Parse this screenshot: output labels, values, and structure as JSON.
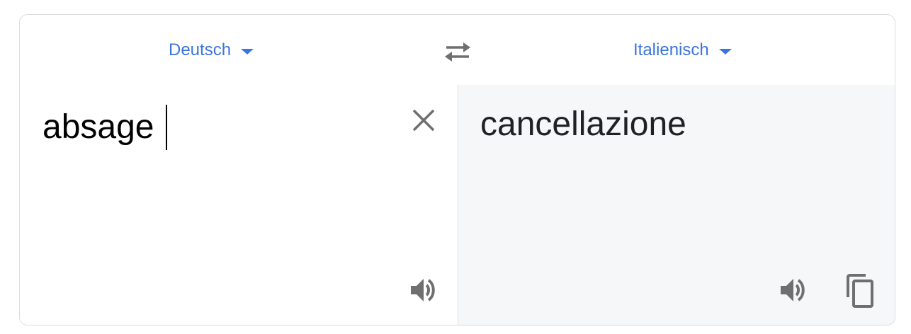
{
  "source_language": {
    "label": "Deutsch"
  },
  "target_language": {
    "label": "Italienisch"
  },
  "source": {
    "text": "absage"
  },
  "target": {
    "text": "cancellazione"
  },
  "icons": {
    "swap": "swap-arrows-icon",
    "clear": "close-icon",
    "speaker": "speaker-icon",
    "copy": "copy-icon"
  },
  "colors": {
    "accent": "#3a75de",
    "icon": "#6f6f6f",
    "target_bg": "#f6f7f9",
    "border": "#dadce0"
  }
}
